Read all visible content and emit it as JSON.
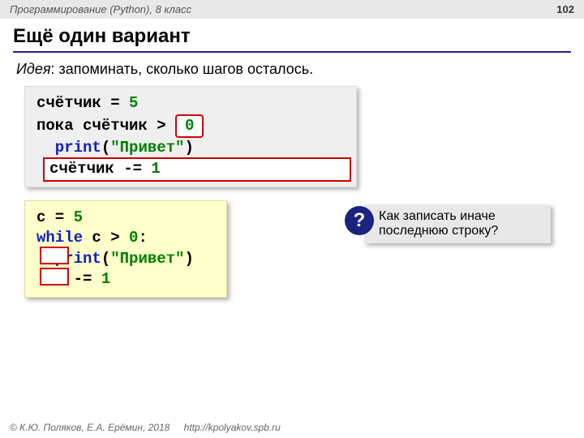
{
  "header": {
    "course": "Программирование (Python), 8 класс",
    "page": "102"
  },
  "title": "Ещё один вариант",
  "idea": {
    "label": "Идея",
    "text": ": запоминать, сколько шагов осталось."
  },
  "code1": {
    "l1a": "счётчик = ",
    "l1b": "5",
    "l2a": "пока счётчик > ",
    "l2box": "0",
    "l3a": "  print",
    "l3b": "(",
    "l3c": "\"Привет\"",
    "l3d": ")",
    "l4a": "счётчик -= ",
    "l4b": "1"
  },
  "code2": {
    "l1a": "c = ",
    "l1b": "5",
    "l2a": "while",
    "l2b": " c > ",
    "l2c": "0",
    "l2d": ":",
    "l3a": "  print",
    "l3b": "(",
    "l3c": "\"Привет\"",
    "l3d": ")",
    "l4a": "  c -= ",
    "l4b": "1"
  },
  "callout": {
    "mark": "?",
    "text": "Как записать иначе последнюю строку?"
  },
  "footer": {
    "copyright": "© К.Ю. Поляков, Е.А. Ерёмин, 2018",
    "url": "http://kpolyakov.spb.ru"
  }
}
